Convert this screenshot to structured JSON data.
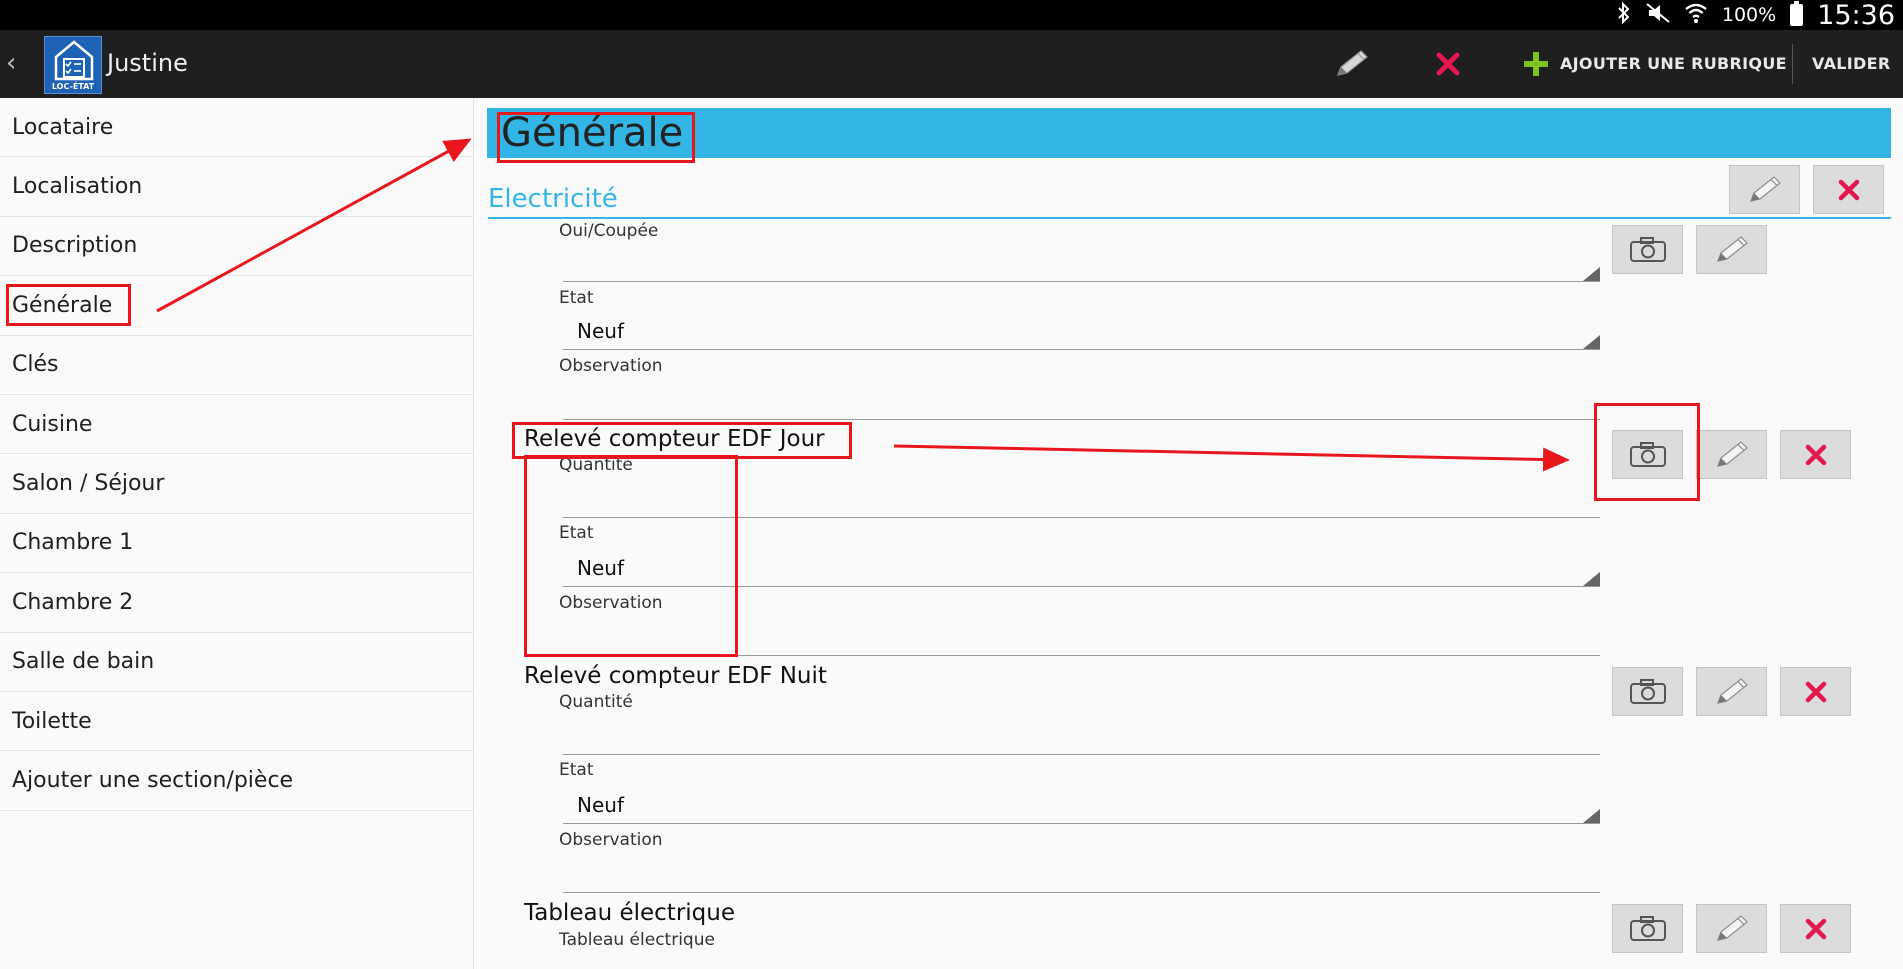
{
  "status_bar": {
    "battery_percent": "100%",
    "time": "15:36"
  },
  "action_bar": {
    "app_name": "Justine",
    "logo_text": "LOC-ÉTAT",
    "add_label": "AJOUTER UNE RUBRIQUE",
    "validate_label": "VALIDER"
  },
  "sidebar": {
    "items": [
      {
        "label": "Locataire"
      },
      {
        "label": "Localisation"
      },
      {
        "label": "Description"
      },
      {
        "label": "Générale"
      },
      {
        "label": "Clés"
      },
      {
        "label": "Cuisine"
      },
      {
        "label": "Salon / Séjour"
      },
      {
        "label": "Chambre 1"
      },
      {
        "label": "Chambre 2"
      },
      {
        "label": "Salle de bain"
      },
      {
        "label": "Toilette"
      },
      {
        "label": "Ajouter une section/pièce"
      }
    ]
  },
  "main": {
    "section_title": "Générale",
    "subsection_title": "Electricité",
    "first_item": {
      "field1_label": "Oui/Coupée",
      "etat_label": "Etat",
      "etat_value": "Neuf",
      "observation_label": "Observation"
    },
    "items": [
      {
        "title": "Relevé compteur EDF Jour",
        "quantity_label": "Quantité",
        "etat_label": "Etat",
        "etat_value": "Neuf",
        "observation_label": "Observation"
      },
      {
        "title": "Relevé compteur EDF Nuit",
        "quantity_label": "Quantité",
        "etat_label": "Etat",
        "etat_value": "Neuf",
        "observation_label": "Observation"
      },
      {
        "title": "Tableau électrique",
        "sub_label": "Tableau électrique"
      }
    ]
  },
  "colors": {
    "accent_blue": "#33b5e5",
    "annotation_red": "#e8171e",
    "delete_pink": "#e4174f",
    "add_green": "#7fc31c"
  },
  "icons": [
    "back-chevron-icon",
    "app-logo",
    "pencil-icon",
    "delete-x-icon",
    "plus-icon",
    "camera-icon",
    "bluetooth-icon",
    "mute-icon",
    "wifi-icon",
    "battery-icon"
  ]
}
